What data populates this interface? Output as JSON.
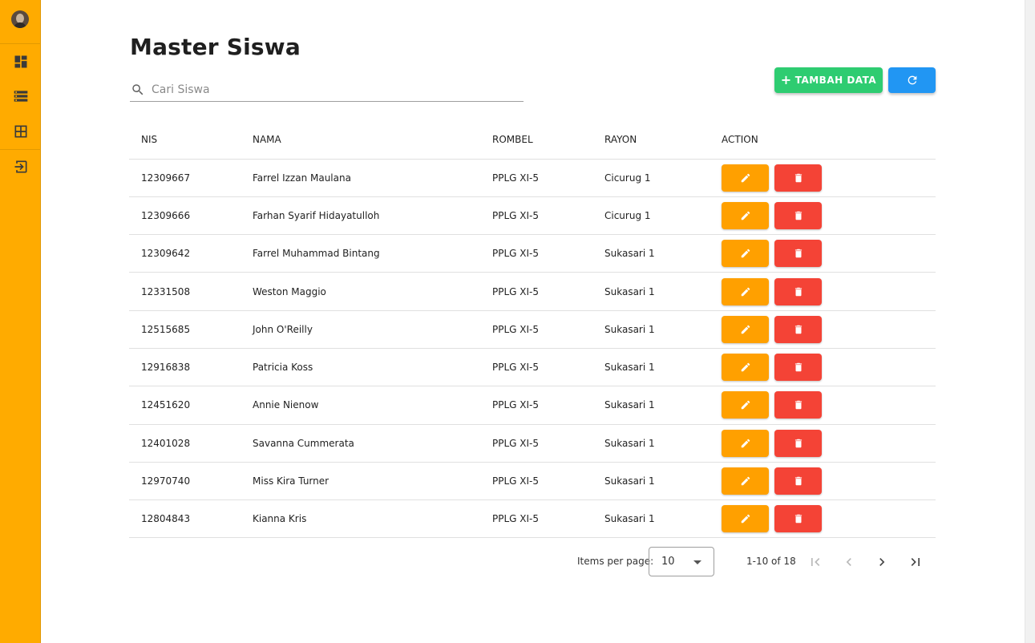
{
  "page": {
    "title": "Master Siswa"
  },
  "sidebar": {
    "items": [
      {
        "name": "dashboard",
        "icon": "dashboard-icon"
      },
      {
        "name": "data",
        "icon": "storage-icon"
      },
      {
        "name": "table",
        "icon": "table-icon"
      },
      {
        "name": "logout",
        "icon": "logout-icon"
      }
    ]
  },
  "search": {
    "placeholder": "Cari Siswa",
    "value": ""
  },
  "toolbar": {
    "add_label": "TAMBAH DATA",
    "add_icon": "+"
  },
  "table": {
    "headers": {
      "nis": "NIS",
      "nama": "NAMA",
      "rombel": "ROMBEL",
      "rayon": "RAYON",
      "action": "ACTION"
    },
    "rows": [
      {
        "nis": "12309667",
        "nama": "Farrel Izzan Maulana",
        "rombel": "PPLG XI-5",
        "rayon": "Cicurug 1"
      },
      {
        "nis": "12309666",
        "nama": "Farhan Syarif Hidayatulloh",
        "rombel": "PPLG XI-5",
        "rayon": "Cicurug 1"
      },
      {
        "nis": "12309642",
        "nama": "Farrel Muhammad Bintang",
        "rombel": "PPLG XI-5",
        "rayon": "Sukasari 1"
      },
      {
        "nis": "12331508",
        "nama": "Weston Maggio",
        "rombel": "PPLG XI-5",
        "rayon": "Sukasari 1"
      },
      {
        "nis": "12515685",
        "nama": "John O'Reilly",
        "rombel": "PPLG XI-5",
        "rayon": "Sukasari 1"
      },
      {
        "nis": "12916838",
        "nama": "Patricia Koss",
        "rombel": "PPLG XI-5",
        "rayon": "Sukasari 1"
      },
      {
        "nis": "12451620",
        "nama": "Annie Nienow",
        "rombel": "PPLG XI-5",
        "rayon": "Sukasari 1"
      },
      {
        "nis": "12401028",
        "nama": "Savanna Cummerata",
        "rombel": "PPLG XI-5",
        "rayon": "Sukasari 1"
      },
      {
        "nis": "12970740",
        "nama": "Miss Kira Turner",
        "rombel": "PPLG XI-5",
        "rayon": "Sukasari 1"
      },
      {
        "nis": "12804843",
        "nama": "Kianna Kris",
        "rombel": "PPLG XI-5",
        "rayon": "Sukasari 1"
      }
    ]
  },
  "pagination": {
    "items_per_page_label": "Items per page:",
    "items_per_page": "10",
    "range": "1-10 of 18"
  },
  "colors": {
    "sidebar": "#ffab00",
    "add_button": "#2ecc71",
    "refresh_button": "#2196f3",
    "edit_button": "#ffa000",
    "delete_button": "#f44336"
  }
}
